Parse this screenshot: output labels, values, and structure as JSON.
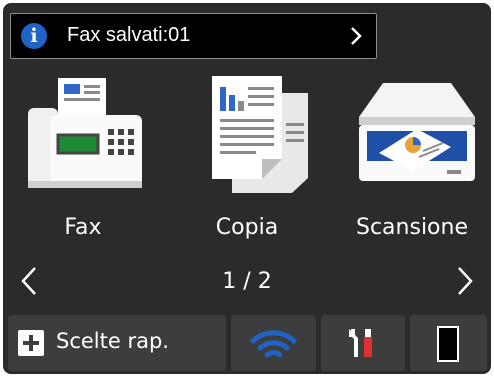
{
  "notification": {
    "text": "Fax salvati:01",
    "icon": "info-icon",
    "action_icon": "chevron-right-icon"
  },
  "tiles": [
    {
      "label": "Fax",
      "icon": "fax-machine-icon"
    },
    {
      "label": "Copia",
      "icon": "copy-documents-icon"
    },
    {
      "label": "Scansione",
      "icon": "scanner-icon"
    }
  ],
  "pager": {
    "text": "1 / 2",
    "prev_icon": "chevron-left-icon",
    "next_icon": "chevron-right-icon"
  },
  "bottom_bar": {
    "shortcuts_label": "Scelte rap.",
    "shortcuts_icon": "plus-icon",
    "wifi_icon": "wifi-icon",
    "tools_icon": "settings-tools-icon",
    "toner_icon": "toner-icon"
  },
  "colors": {
    "background": "#2b2b2b",
    "info_blue": "#1f63c6",
    "wifi_blue": "#1f63c6",
    "accent_red": "#e03030"
  }
}
